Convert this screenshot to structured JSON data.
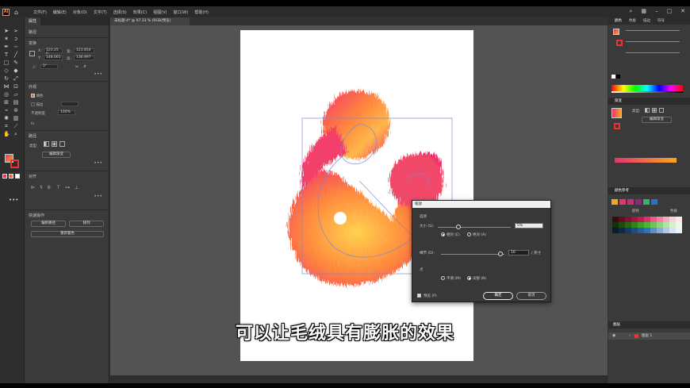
{
  "app": {
    "logo_text": "Ai",
    "menu": [
      "文件(F)",
      "编辑(E)",
      "对象(O)",
      "文字(T)",
      "选择(S)",
      "效果(C)",
      "视图(V)",
      "窗口(W)",
      "帮助(H)"
    ]
  },
  "document_tab": {
    "title": "未标题-4* @ 97.33 % (RGB/预览)"
  },
  "properties_panel": {
    "tab": "属性",
    "section_path": "路径",
    "section_transform": "变换",
    "x_value": "123.25 n",
    "y_value": "148.061",
    "w_value": "123.854",
    "h_value": "136.997",
    "rotation_value": "0°",
    "section_appearance": "外观",
    "fill_label": "填色",
    "stroke_label": "描边",
    "opacity_label": "不透明度",
    "opacity_value": "100%",
    "fx_label": "fx",
    "section_quick": "快速操作",
    "section_align": "对齐",
    "edit_gradient_button": "编辑渐变",
    "gradient_type_label": "类型:",
    "quick_actions": {
      "offset_path": "偏移路径",
      "arrange": "排列",
      "recolor": "重新着色"
    }
  },
  "scale_dialog": {
    "title": "缩放",
    "options_label": "选项",
    "size_label": "大小 (S):",
    "size_value": "5%",
    "relative_label": "相对 (E)",
    "absolute_label": "绝对 (A)",
    "detail_label": "细节 (D):",
    "detail_value": "10",
    "detail_unit": "/ 英寸",
    "points_label": "点",
    "smooth_label": "平滑 (M)",
    "corner_label": "尖锐 (N)",
    "preview_label": "预览 (P)",
    "ok_label": "确定",
    "cancel_label": "取消",
    "size_selected": "relative",
    "points_selected": "corner",
    "preview_checked": true
  },
  "right_panels": {
    "color_tabs": [
      "颜色",
      "色板",
      "描边",
      "符号"
    ],
    "gradient_header": "渐变",
    "gradient_type_label": "类型:",
    "edit_gradient_button": "编辑渐变",
    "swatches_header": "颜色参考",
    "swatches_theme": "颜色",
    "swatches_sub": "色板",
    "layers_header": "图层",
    "layer_name": "图层 1",
    "gradient_start": "#e9336d",
    "gradient_end": "#f5a623"
  },
  "subtitle": "可以让毛绒具有膨胀的效果",
  "colors": {
    "accent_orange": "#ff9a00",
    "fur_pink": "#f02d6e",
    "fur_orange": "#ff8a3d",
    "fur_yellow": "#ffcf45",
    "path_blue": "#7d86d8"
  }
}
